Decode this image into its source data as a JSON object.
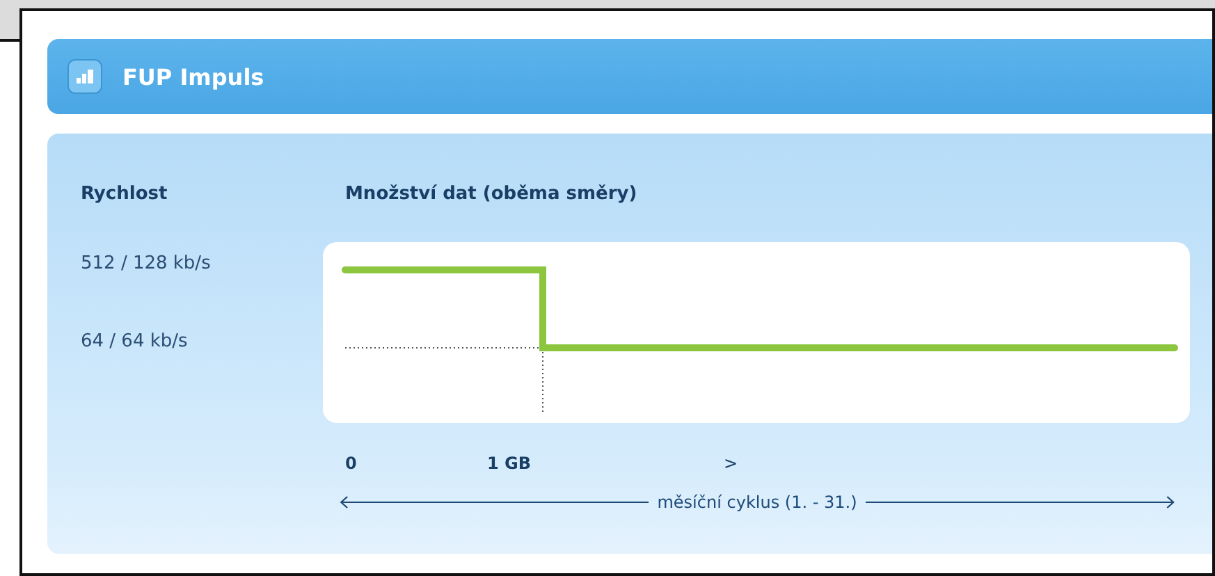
{
  "widget": {
    "title": "FUP Impuls"
  },
  "speed": {
    "heading": "Rychlost",
    "levels": [
      "512 / 128 kb/s",
      "64 / 64 kb/s"
    ]
  },
  "data": {
    "heading": "Množství dat (oběma směry)",
    "x_labels": [
      "0",
      "1 GB",
      ">"
    ],
    "cycle": "měsíční cyklus (1. - 31.)"
  }
}
